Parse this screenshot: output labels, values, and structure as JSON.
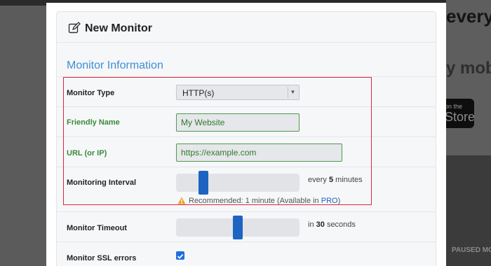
{
  "background": {
    "headline": "every",
    "subline": "y mobi",
    "store_small": "on the",
    "store_big": "Store",
    "paused": "PAUSED MO"
  },
  "modal": {
    "title": "New Monitor",
    "section_title": "Monitor Information",
    "monitor_type": {
      "label": "Monitor Type",
      "value": "HTTP(s)"
    },
    "friendly_name": {
      "label": "Friendly Name",
      "value": "My Website"
    },
    "url": {
      "label": "URL (or IP)",
      "value": "https://example.com"
    },
    "interval": {
      "label": "Monitoring Interval",
      "caption_prefix": "every",
      "value": "5",
      "caption_suffix": "minutes",
      "slider_fraction": 0.2,
      "hint_prefix": "Recommended: 1 minute (Available in",
      "hint_link": "PRO",
      "hint_suffix": ")"
    },
    "timeout": {
      "label": "Monitor Timeout",
      "caption_prefix": "in",
      "value": "30",
      "caption_suffix": "seconds",
      "slider_fraction": 0.5
    },
    "ssl": {
      "label": "Monitor SSL errors",
      "checked": true
    }
  },
  "colors": {
    "accent": "#1d63c2",
    "section": "#3d8fd6",
    "valid": "#4e9a4e",
    "highlight": "#d9283c"
  }
}
